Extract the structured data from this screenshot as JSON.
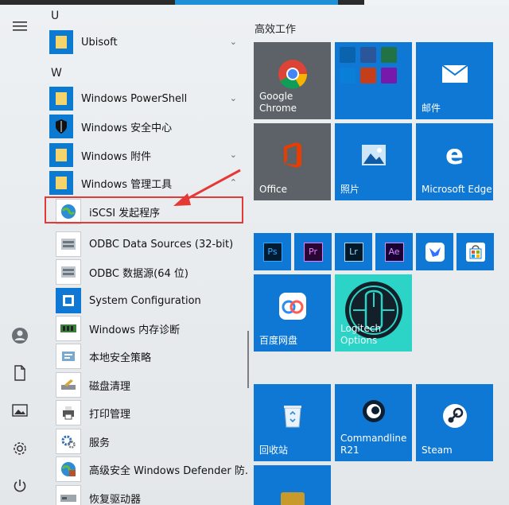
{
  "rail": {
    "icons": [
      "hamburger-menu-icon",
      "user-avatar-icon",
      "documents-icon",
      "pictures-icon",
      "settings-icon",
      "power-icon"
    ]
  },
  "applist": {
    "sections": [
      {
        "letter": "U",
        "items": [
          {
            "label": "Ubisoft",
            "type": "folder",
            "expand": true
          }
        ]
      },
      {
        "letter": "W",
        "items": [
          {
            "label": "Windows PowerShell",
            "type": "folder",
            "expand": true
          },
          {
            "label": "Windows 安全中心",
            "type": "shield",
            "expand": false
          },
          {
            "label": "Windows 附件",
            "type": "folder",
            "expand": true
          },
          {
            "label": "Windows 管理工具",
            "type": "folder",
            "expand": true
          }
        ]
      }
    ],
    "subitems": [
      {
        "label": "iSCSI 发起程序",
        "icon": "globe-icon"
      },
      {
        "label": "ODBC Data Sources (32-bit)",
        "icon": "database-icon"
      },
      {
        "label": "ODBC 数据源(64 位)",
        "icon": "database-icon"
      },
      {
        "label": "System Configuration",
        "icon": "system-config-icon"
      },
      {
        "label": "Windows 内存诊断",
        "icon": "memory-chip-icon"
      },
      {
        "label": "本地安全策略",
        "icon": "security-policy-icon"
      },
      {
        "label": "磁盘清理",
        "icon": "disk-cleanup-icon"
      },
      {
        "label": "打印管理",
        "icon": "printer-icon"
      },
      {
        "label": "服务",
        "icon": "services-gear-icon"
      },
      {
        "label": "高级安全 Windows Defender 防...",
        "icon": "firewall-icon"
      },
      {
        "label": "恢复驱动器",
        "icon": "recovery-drive-icon"
      }
    ]
  },
  "tiles": {
    "section_title": "高效工作",
    "google_chrome": "Google Chrome",
    "office": "Office",
    "photos": "照片",
    "mail": "邮件",
    "edge": "Microsoft Edge",
    "baidu": "百度网盘",
    "logitech": "Logitech Options",
    "recycle": "回收站",
    "commandline": "Commandline R21",
    "steam": "Steam",
    "small_apps": [
      "Ps",
      "Pr",
      "Lr",
      "Ae"
    ]
  },
  "colors": {
    "accent": "#0e78d4",
    "highlight": "#e53935"
  }
}
